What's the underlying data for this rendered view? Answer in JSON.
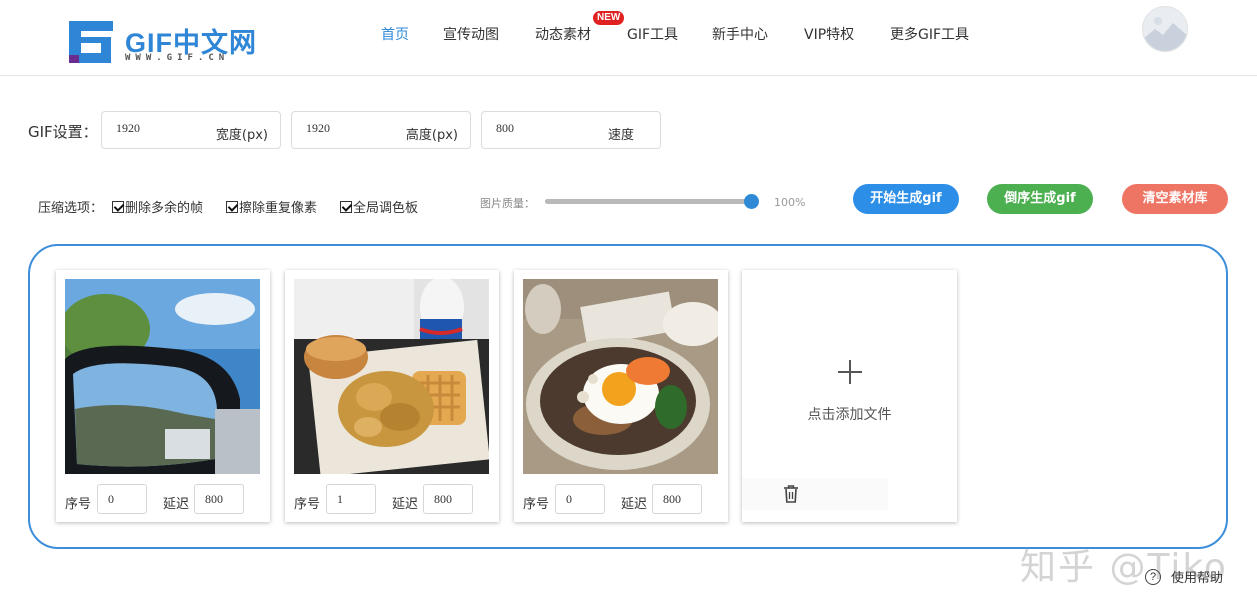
{
  "brand": {
    "logo_text": "GIF中文网",
    "logo_sub": "WWW.GIF.CN",
    "colors": {
      "primary": "#2f85d6",
      "accent_purple": "#6a2c8f"
    }
  },
  "nav": {
    "items": [
      {
        "label": "首页",
        "active": true
      },
      {
        "label": "宣传动图"
      },
      {
        "label": "动态素材"
      },
      {
        "label": "GIF工具"
      },
      {
        "label": "新手中心"
      },
      {
        "label": "VIP特权"
      },
      {
        "label": "更多GIF工具"
      }
    ],
    "badge": "NEW"
  },
  "settings": {
    "label": "GIF设置：",
    "width": {
      "value": "1920",
      "unit": "宽度(px)"
    },
    "height": {
      "value": "1920",
      "unit": "高度(px)"
    },
    "speed": {
      "value": "800",
      "unit": "速度"
    }
  },
  "options": {
    "label": "压缩选项：",
    "checkboxes": [
      {
        "label": "删除多余的帧",
        "checked": true
      },
      {
        "label": "擦除重复像素",
        "checked": true
      },
      {
        "label": "全局调色板",
        "checked": true
      }
    ],
    "quality_label": "图片质量：",
    "quality_value": "100%",
    "quality_fraction": 1.0
  },
  "actions": {
    "start": "开始生成gif",
    "reverse": "倒序生成gif",
    "clear": "清空素材库",
    "colors": {
      "start": "#2d8ee8",
      "reverse": "#4caf50",
      "clear": "#ee7564"
    }
  },
  "frames": {
    "index_label": "序号",
    "delay_label": "延迟",
    "items": [
      {
        "index": "0",
        "delay": "800",
        "image": "car-mirror-photo"
      },
      {
        "index": "1",
        "delay": "800",
        "image": "fried-chicken-waffle-photo"
      },
      {
        "index": "0",
        "delay": "800",
        "image": "rice-bowl-egg-photo"
      }
    ]
  },
  "add_file": {
    "label": "点击添加文件"
  },
  "watermark": "知乎 @Tiko",
  "help": {
    "label": "使用帮助"
  }
}
